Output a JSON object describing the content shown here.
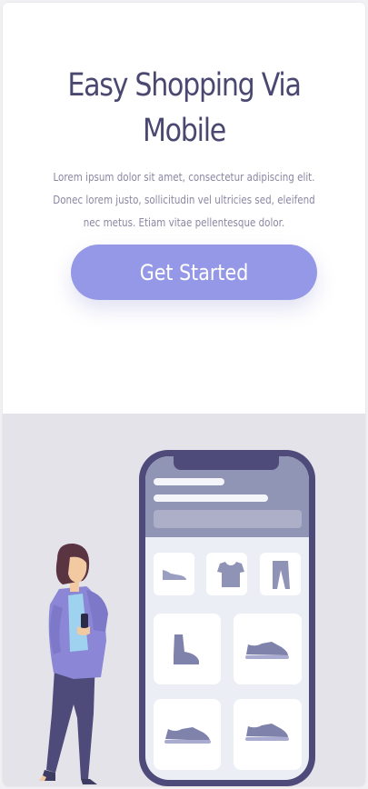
{
  "hero": {
    "title": "Easy Shopping Via Mobile",
    "description": "Lorem ipsum dolor sit amet, consectetur adipiscing elit. Donec lorem justo, sollicitudin vel ultricies sed, eleifend nec metus. Etiam vitae pellentesque dolor.",
    "cta_label": "Get Started"
  },
  "colors": {
    "accent": "#9598e6",
    "title": "#4a4870",
    "body_text": "#8a87a2",
    "illustration_bg": "#e3e3e9",
    "phone_frame": "#4e4b7a"
  },
  "illustration": {
    "phone_products": [
      "shoe-icon",
      "tshirt-icon",
      "pants-icon",
      "boot-icon",
      "sneaker-icon",
      "sneaker-icon",
      "sneaker-icon"
    ]
  }
}
